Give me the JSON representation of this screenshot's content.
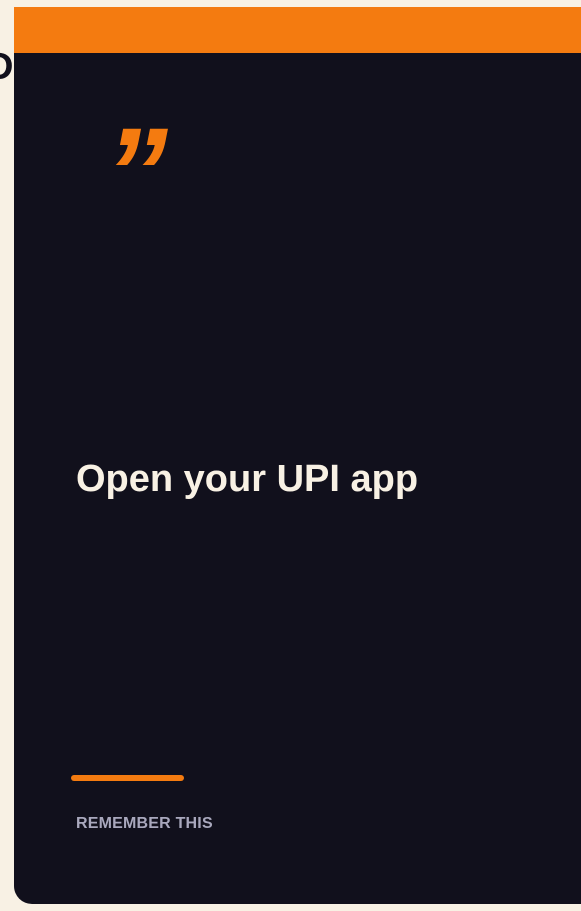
{
  "edge": {
    "glyph": "D"
  },
  "card": {
    "quote_glyph": "”",
    "headline": "Open your UPI app",
    "footer_label": "REMEMBER THIS"
  },
  "colors": {
    "background": "#f8f1e4",
    "card": "#11101c",
    "accent": "#f47b10",
    "headline": "#f8f1e4",
    "muted": "#a9a8bd"
  },
  "icons": {
    "quote_mark": "closing-quote-icon"
  }
}
